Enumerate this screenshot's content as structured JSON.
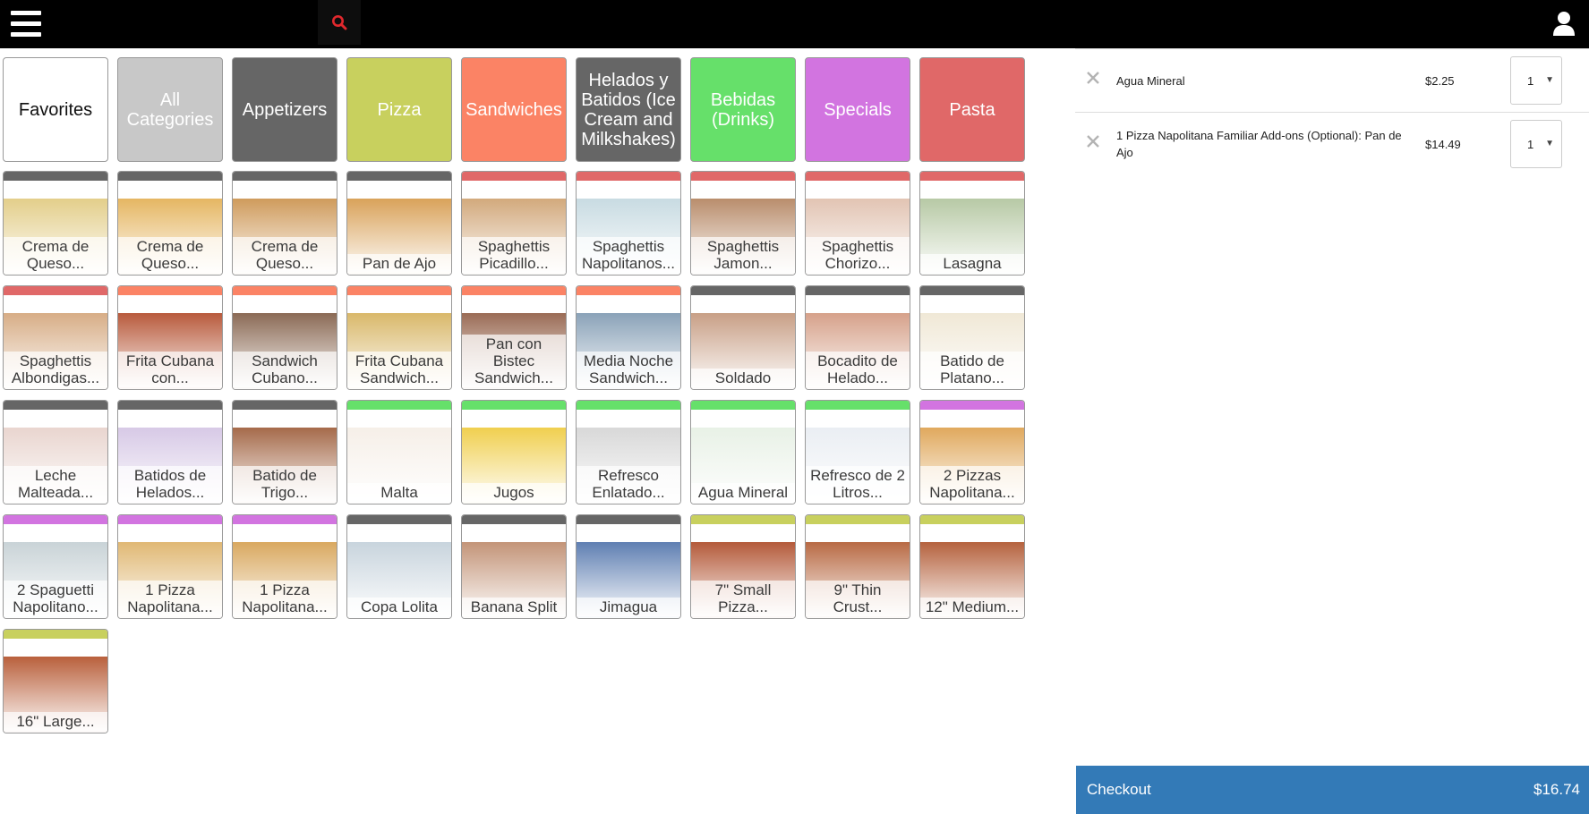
{
  "header": {
    "menu_icon": "hamburger-icon",
    "search_icon": "search-icon",
    "user_icon": "user-icon"
  },
  "categories": [
    {
      "label": "Favorites",
      "color": "#ffffff"
    },
    {
      "label": "All Categories",
      "color": "#c8c8c8"
    },
    {
      "label": "Appetizers",
      "color": "#666666"
    },
    {
      "label": "Pizza",
      "color": "#c8d05e"
    },
    {
      "label": "Sandwiches",
      "color": "#fb8365"
    },
    {
      "label": "Helados y Batidos (Ice Cream and Milkshakes)",
      "color": "#666666"
    },
    {
      "label": "Bebidas (Drinks)",
      "color": "#66e06a"
    },
    {
      "label": "Specials",
      "color": "#d274e0"
    },
    {
      "label": "Pasta",
      "color": "#e06868"
    }
  ],
  "items": [
    {
      "label": "Crema de Queso...",
      "strip": "#666666",
      "photo": "#e3ce8a"
    },
    {
      "label": "Crema de Queso...",
      "strip": "#666666",
      "photo": "#e5b662"
    },
    {
      "label": "Crema de Queso...",
      "strip": "#666666",
      "photo": "#cf9b5c"
    },
    {
      "label": "Pan de Ajo",
      "strip": "#666666",
      "photo": "#d9a25a"
    },
    {
      "label": "Spaghettis Picadillo...",
      "strip": "#e06868",
      "photo": "#d2a97c"
    },
    {
      "label": "Spaghettis Napolitanos...",
      "strip": "#e06868",
      "photo": "#c8dbe2"
    },
    {
      "label": "Spaghettis Jamon...",
      "strip": "#e06868",
      "photo": "#b98d6c"
    },
    {
      "label": "Spaghettis Chorizo...",
      "strip": "#e06868",
      "photo": "#e2c4b3"
    },
    {
      "label": "Lasagna",
      "strip": "#e06868",
      "photo": "#b7c9a5"
    },
    {
      "label": "Spaghettis Albondigas...",
      "strip": "#e06868",
      "photo": "#d7ad86"
    },
    {
      "label": "Frita Cubana con...",
      "strip": "#fb8365",
      "photo": "#b85a3c"
    },
    {
      "label": "Sandwich Cubano...",
      "strip": "#fb8365",
      "photo": "#8b6a55"
    },
    {
      "label": "Frita Cubana Sandwich...",
      "strip": "#fb8365",
      "photo": "#d9b86a"
    },
    {
      "label": "Pan con Bistec Sandwich...",
      "strip": "#fb8365",
      "photo": "#9a6b55"
    },
    {
      "label": "Media Noche Sandwich...",
      "strip": "#fb8365",
      "photo": "#8aa2b8"
    },
    {
      "label": "Soldado",
      "strip": "#666666",
      "photo": "#c89f86"
    },
    {
      "label": "Bocadito de Helado...",
      "strip": "#666666",
      "photo": "#d6a18a"
    },
    {
      "label": "Batido de Platano...",
      "strip": "#666666",
      "photo": "#f0e8d6"
    },
    {
      "label": "Leche Malteada...",
      "strip": "#666666",
      "photo": "#e9d5cf"
    },
    {
      "label": "Batidos de Helados...",
      "strip": "#666666",
      "photo": "#d7c9e6"
    },
    {
      "label": "Batido de Trigo...",
      "strip": "#666666",
      "photo": "#a56a4a"
    },
    {
      "label": "Malta",
      "strip": "#66e06a",
      "photo": "#f6efe8"
    },
    {
      "label": "Jugos",
      "strip": "#66e06a",
      "photo": "#f0cf4f"
    },
    {
      "label": "Refresco Enlatado...",
      "strip": "#66e06a",
      "photo": "#d8d8d8"
    },
    {
      "label": "Agua Mineral",
      "strip": "#66e06a",
      "photo": "#e8f1e6"
    },
    {
      "label": "Refresco de 2 Litros...",
      "strip": "#66e06a",
      "photo": "#eaeef3"
    },
    {
      "label": "2 Pizzas Napolitana...",
      "strip": "#d274e0",
      "photo": "#e0a85d"
    },
    {
      "label": "2 Spaguetti Napolitano...",
      "strip": "#d274e0",
      "photo": "#c9d3d7"
    },
    {
      "label": "1 Pizza Napolitana...",
      "strip": "#d274e0",
      "photo": "#e0b874"
    },
    {
      "label": "1 Pizza Napolitana...",
      "strip": "#d274e0",
      "photo": "#d9a860"
    },
    {
      "label": "Copa Lolita",
      "strip": "#666666",
      "photo": "#c8d4dd"
    },
    {
      "label": "Banana Split",
      "strip": "#666666",
      "photo": "#c39478"
    },
    {
      "label": "Jimagua",
      "strip": "#666666",
      "photo": "#5f7fb2"
    },
    {
      "label": "7\" Small Pizza...",
      "strip": "#c8d05e",
      "photo": "#b45a3a"
    },
    {
      "label": "9\" Thin Crust...",
      "strip": "#c8d05e",
      "photo": "#b86a44"
    },
    {
      "label": "12\" Medium...",
      "strip": "#c8d05e",
      "photo": "#b5623e"
    },
    {
      "label": "16\" Large...",
      "strip": "#c8d05e",
      "photo": "#b9603c"
    }
  ],
  "order": {
    "remove_icon": "close-icon",
    "lines": [
      {
        "name": "Agua Mineral",
        "price": "$2.25",
        "qty": "1"
      },
      {
        "name": "1 Pizza Napolitana Familiar Add-ons (Optional): Pan de Ajo",
        "price": "$14.49",
        "qty": "1"
      }
    ]
  },
  "checkout": {
    "label": "Checkout",
    "total": "$16.74"
  }
}
